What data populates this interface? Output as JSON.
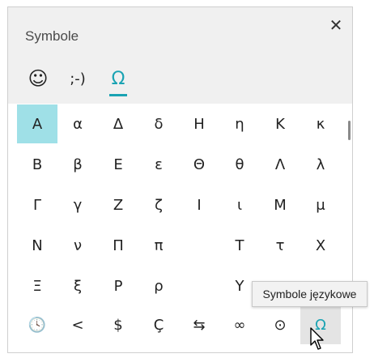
{
  "window": {
    "title": "Symbole",
    "close_glyph": "✕"
  },
  "tabs": [
    {
      "label": "☺",
      "icon": "smiley-icon",
      "active": false
    },
    {
      "label": ";-)",
      "icon": "kaomoji-icon",
      "active": false
    },
    {
      "label": "Ω",
      "icon": "omega-icon",
      "active": true
    }
  ],
  "grid": {
    "rows": [
      [
        "Α",
        "α",
        "Δ",
        "δ",
        "Η",
        "η",
        "Κ",
        "κ"
      ],
      [
        "Β",
        "β",
        "Ε",
        "ε",
        "Θ",
        "θ",
        "Λ",
        "λ"
      ],
      [
        "Γ",
        "γ",
        "Ζ",
        "ζ",
        "Ι",
        "ι",
        "Μ",
        "μ"
      ],
      [
        "Ν",
        "ν",
        "Π",
        "π",
        "",
        "Τ",
        "τ",
        "Χ"
      ],
      [
        "Ξ",
        "ξ",
        "Ρ",
        "ρ",
        "",
        "Υ",
        "",
        ""
      ]
    ],
    "selected_symbol": "Α"
  },
  "category_bar": [
    {
      "label": "🕓",
      "icon": "clock-icon"
    },
    {
      "label": "<",
      "icon": "less-than-icon"
    },
    {
      "label": "$",
      "icon": "dollar-icon"
    },
    {
      "label": "Ç",
      "icon": "c-cedilla-icon"
    },
    {
      "label": "⇆",
      "icon": "arrows-icon"
    },
    {
      "label": "∞",
      "icon": "infinity-icon"
    },
    {
      "label": "⊙",
      "icon": "circled-dot-icon"
    },
    {
      "label": "Ω",
      "icon": "omega-icon",
      "hovered": true
    }
  ],
  "tooltip": {
    "text": "Symbole językowe"
  },
  "colors": {
    "accent": "#1aa3b3",
    "selected_bg": "#9fe0e7",
    "header_bg": "#f0f0f0"
  }
}
